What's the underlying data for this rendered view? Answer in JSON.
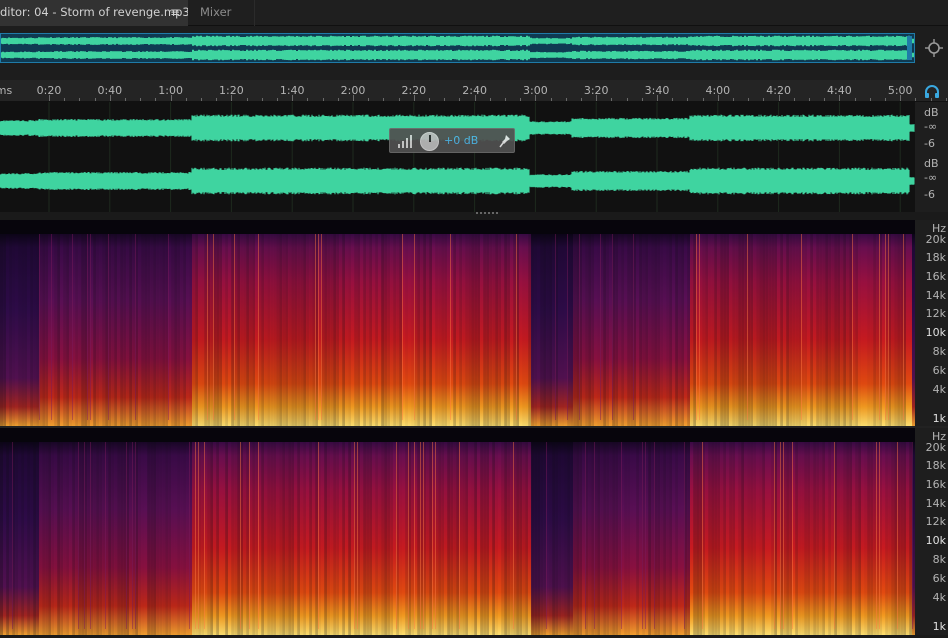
{
  "tabs": {
    "editor_label": "ditor: 04 - Storm of revenge.mp3",
    "editor_menu": "≡",
    "mixer_label": "Mixer"
  },
  "ruler": {
    "unit": "ms",
    "ticks": [
      "0:20",
      "0:40",
      "1:00",
      "1:20",
      "1:40",
      "2:00",
      "2:20",
      "2:40",
      "3:00",
      "3:20",
      "3:40",
      "4:00",
      "4:20",
      "4:40",
      "5:00"
    ]
  },
  "waveform": {
    "db_unit": "dB",
    "db_inf": "-∞",
    "db_minus6": "-6",
    "wave_color": "#3fd4a0"
  },
  "hud": {
    "value": "+0 dB"
  },
  "spectrogram": {
    "hz_unit": "Hz",
    "labels": [
      "20k",
      "18k",
      "16k",
      "14k",
      "12k",
      "10k",
      "8k",
      "6k",
      "4k",
      "1k"
    ]
  },
  "icons": {
    "zoom": "zoom-selection-icon",
    "headphones": "headphones-icon",
    "pin": "pin-icon",
    "meter": "level-meter-icon",
    "menu": "hamburger-menu-icon"
  }
}
